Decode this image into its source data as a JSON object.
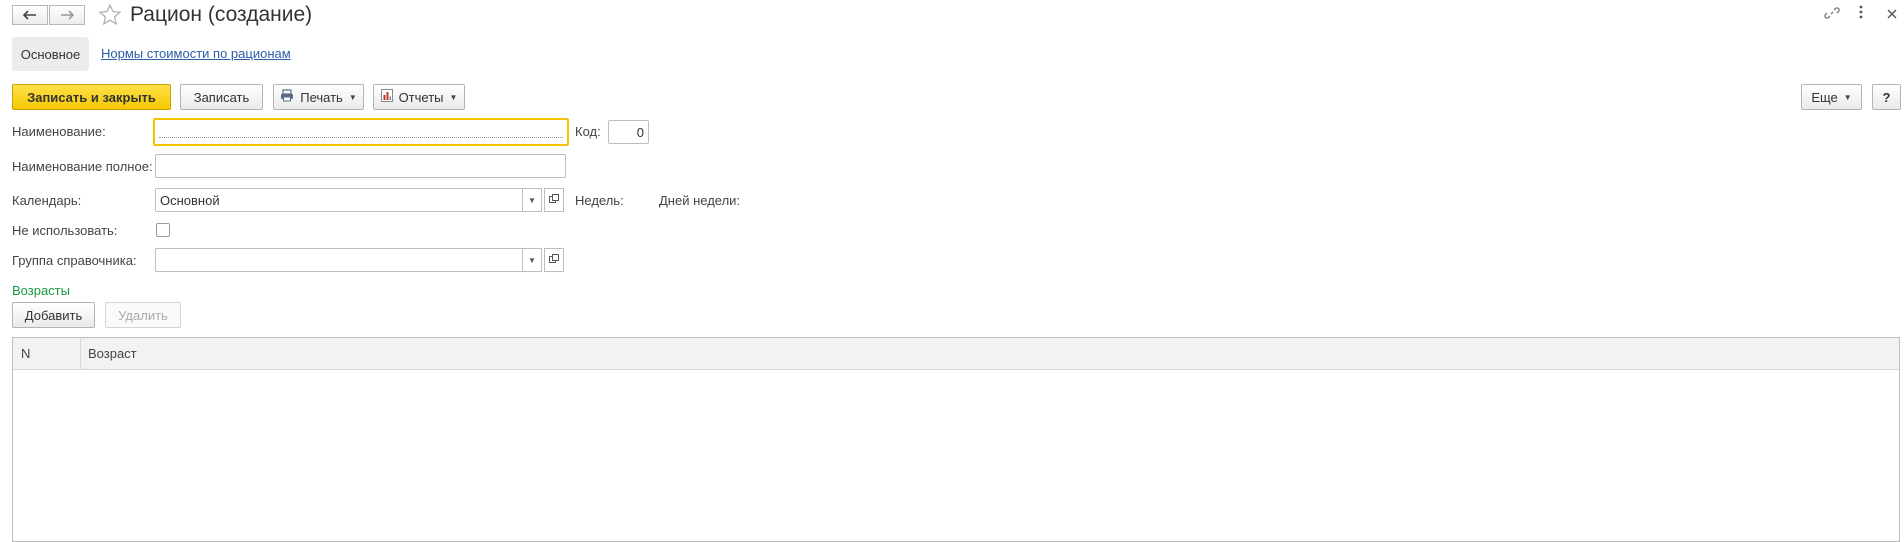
{
  "window": {
    "title": "Рацион (создание)",
    "icons": [
      "back-arrow-icon",
      "forward-arrow-icon",
      "star-icon",
      "link-icon",
      "more-vertical-icon",
      "close-icon"
    ]
  },
  "tabs": {
    "main": "Основное",
    "link": "Нормы стоимости по рационам"
  },
  "toolbar": {
    "save_close": "Записать и закрыть",
    "save": "Записать",
    "print": "Печать",
    "reports": "Отчеты",
    "more": "Еще",
    "help": "?"
  },
  "form": {
    "name_label": "Наименование:",
    "name_value": "",
    "code_label": "Код:",
    "code_value": "0",
    "fullname_label": "Наименование полное:",
    "fullname_value": "",
    "calendar_label": "Календарь:",
    "calendar_value": "Основной",
    "weeks_label": "Недель:",
    "weekdays_label": "Дней недели:",
    "notuse_label": "Не использовать:",
    "notuse_checked": false,
    "group_label": "Группа справочника:",
    "group_value": ""
  },
  "ages": {
    "section_title": "Возрасты",
    "add_label": "Добавить",
    "delete_label": "Удалить",
    "columns": [
      "N",
      "Возраст"
    ],
    "rows": []
  },
  "colors": {
    "accent": "#f5c800",
    "link": "#2a5ea8",
    "section": "#1a9c3e"
  }
}
